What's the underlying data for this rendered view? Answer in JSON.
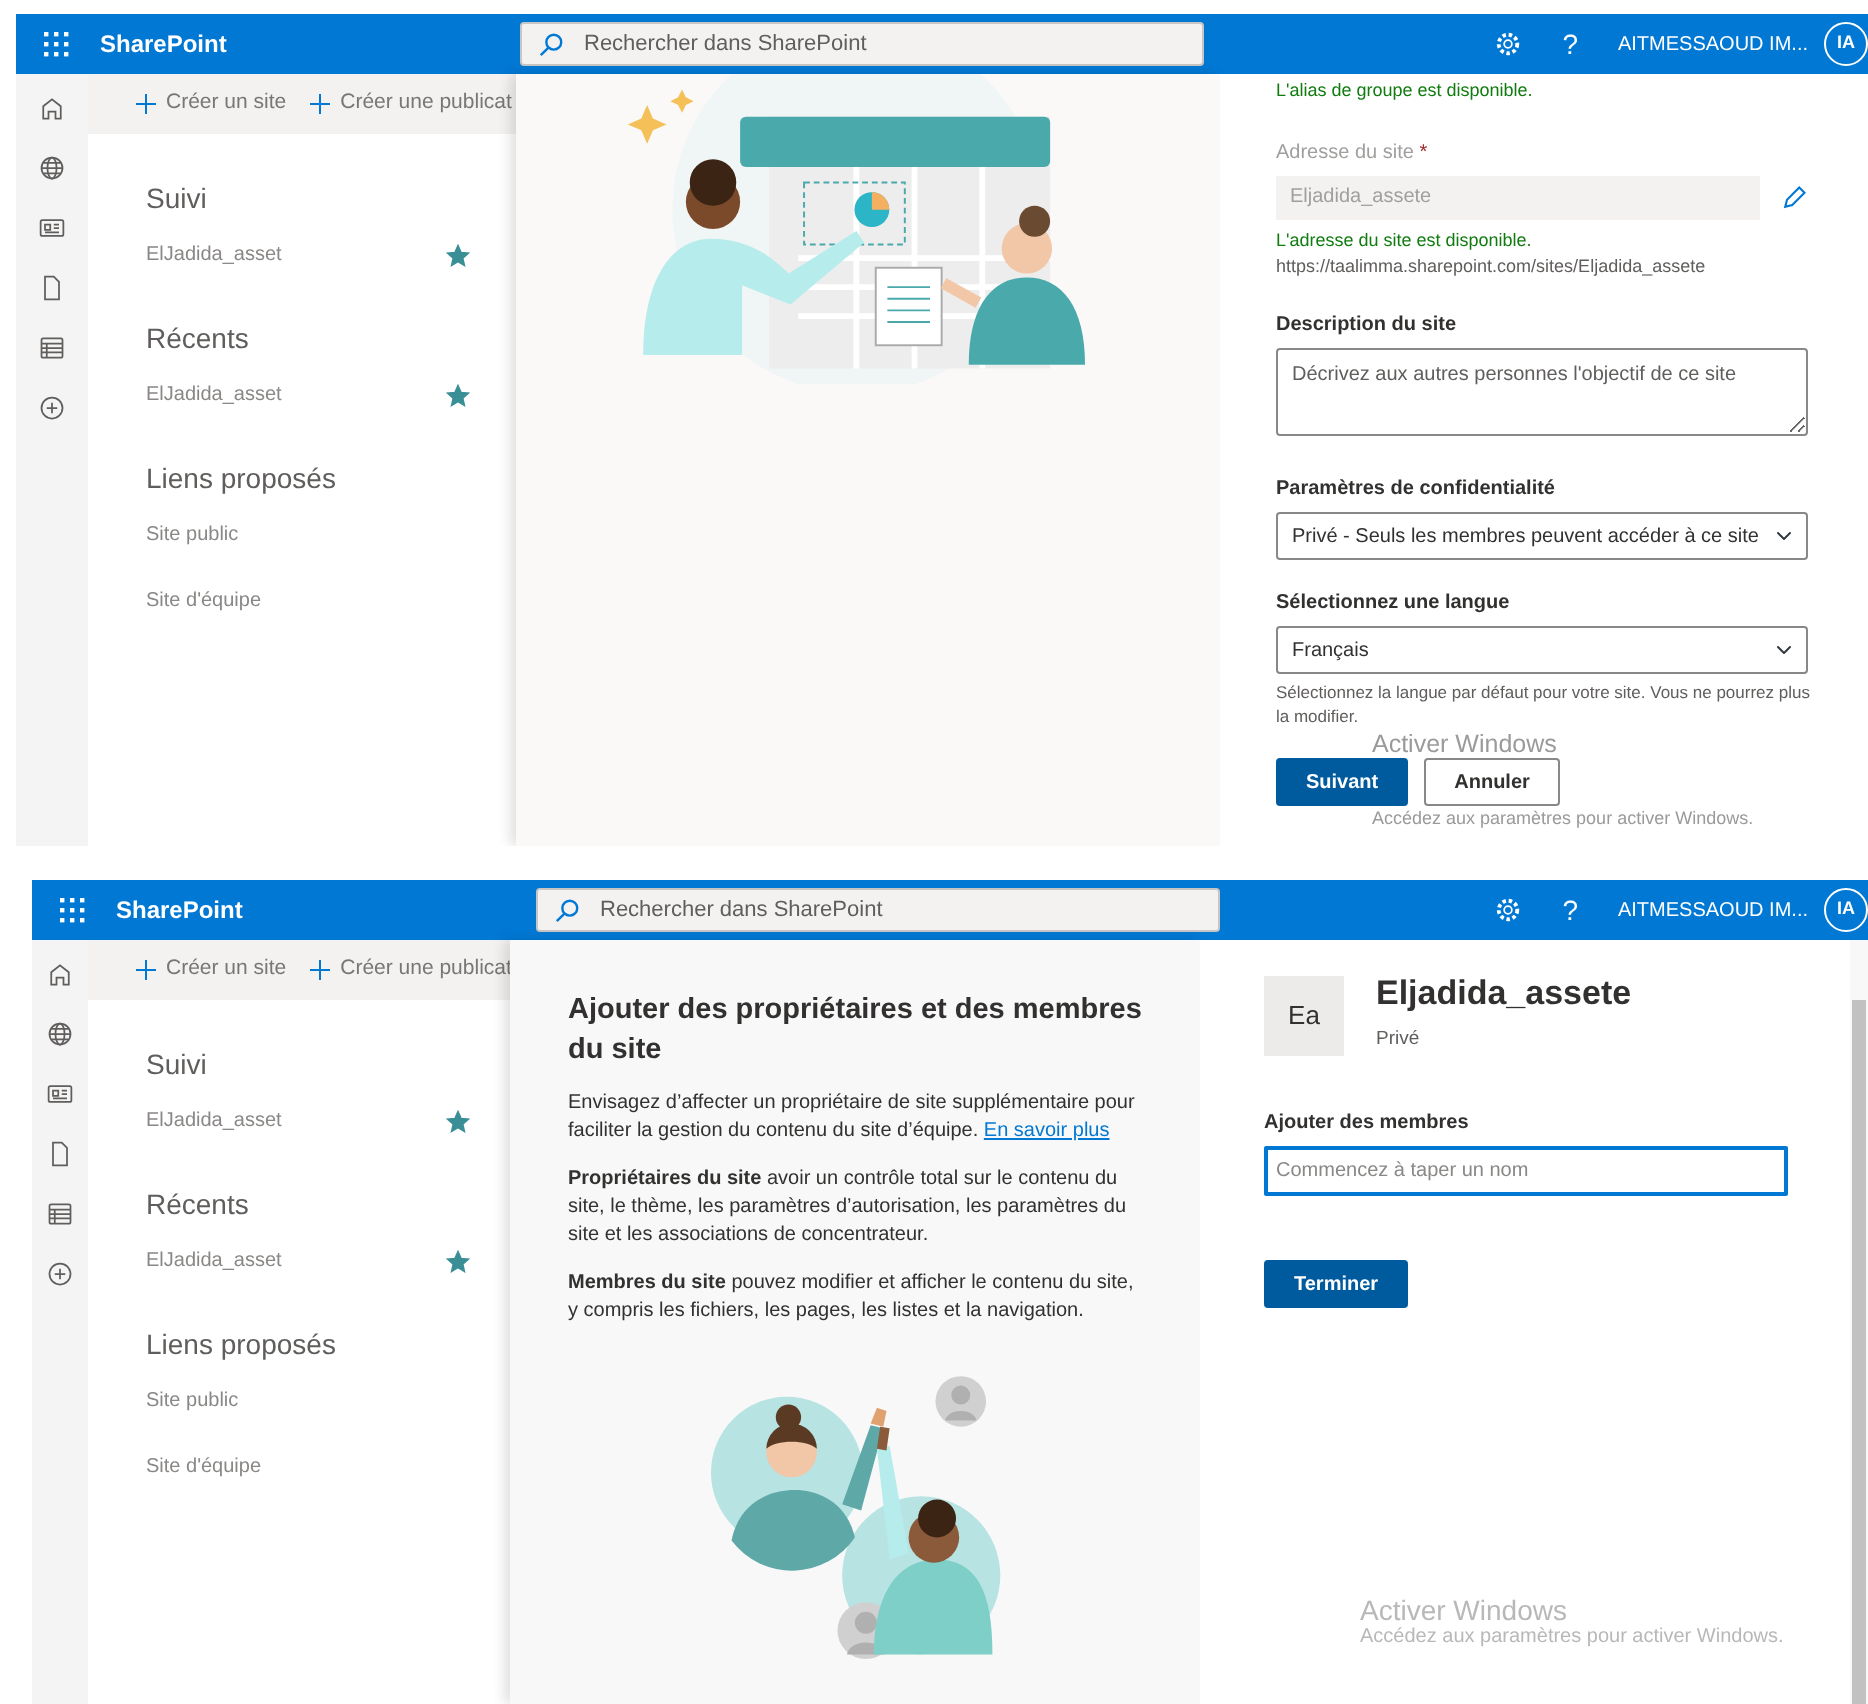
{
  "screens": [
    {
      "kind": "create-site",
      "header": {
        "app_name": "SharePoint",
        "search_placeholder": "Rechercher dans SharePoint",
        "help": "?",
        "user_name": "AITMESSAOUD IM...",
        "avatar_initials": "IA"
      },
      "commands": [
        "Créer un site",
        "Créer une publicat"
      ],
      "nav_sections": [
        {
          "title": "Suivi",
          "items": [
            {
              "label": "ElJadida_asset",
              "favorite": true
            }
          ]
        },
        {
          "title": "Récents",
          "items": [
            {
              "label": "ElJadida_asset",
              "favorite": true
            }
          ]
        },
        {
          "title": "Liens proposés",
          "items": [
            {
              "label": "Site public"
            },
            {
              "label": "Site d'équipe"
            }
          ]
        }
      ],
      "form": {
        "alias_status": "L'alias de groupe est disponible.",
        "address_label": "Adresse du site",
        "required_mark": "*",
        "address_value": "Eljadida_assete",
        "address_status": "L'adresse du site est disponible.",
        "address_url": "https://taalimma.sharepoint.com/sites/Eljadida_assete",
        "description_label": "Description du site",
        "description_placeholder": "Décrivez aux autres personnes l'objectif de ce site",
        "privacy_label": "Paramètres de confidentialité",
        "privacy_value": "Privé - Seuls les membres peuvent accéder à ce site",
        "language_label": "Sélectionnez une langue",
        "language_value": "Français",
        "language_hint": "Sélectionnez la langue par défaut pour votre site. Vous ne pourrez plus la modifier.",
        "buttons": [
          {
            "label": "Suivant",
            "primary": true
          },
          {
            "label": "Annuler",
            "primary": false
          }
        ]
      },
      "activation_notice": {
        "title": "Activer Windows",
        "text": "Accédez aux paramètres pour activer Windows."
      }
    },
    {
      "kind": "add-members",
      "header": {
        "app_name": "SharePoint",
        "search_placeholder": "Rechercher dans SharePoint",
        "help": "?",
        "user_name": "AITMESSAOUD IM...",
        "avatar_initials": "IA"
      },
      "commands": [
        "Créer un site",
        "Créer une publicat"
      ],
      "nav_sections": [
        {
          "title": "Suivi",
          "items": [
            {
              "label": "ElJadida_asset",
              "favorite": true
            }
          ]
        },
        {
          "title": "Récents",
          "items": [
            {
              "label": "ElJadida_asset",
              "favorite": true
            }
          ]
        },
        {
          "title": "Liens proposés",
          "items": [
            {
              "label": "Site public"
            },
            {
              "label": "Site d'équipe"
            }
          ]
        }
      ],
      "intro": {
        "title": "Ajouter des propriétaires et des membres du site",
        "paragraphs": [
          {
            "text": "Envisagez d’affecter un propriétaire de site supplémentaire pour faciliter la gestion du contenu du site d’équipe.",
            "link": "En savoir plus"
          },
          {
            "text": "**Propriétaires du site** avoir un contrôle total sur le contenu du site, le thème, les paramètres d’autorisation, les paramètres du site et les associations de concentrateur."
          },
          {
            "text": "**Membres du site** pouvez modifier et afficher le contenu du site, y compris les fichiers, les pages, les listes et la navigation."
          }
        ]
      },
      "members": {
        "site_initials": "Ea",
        "site_name": "Eljadida_assete",
        "privacy": "Privé",
        "field_label": "Ajouter des membres",
        "field_placeholder": "Commencez à taper un nom",
        "focused": true,
        "buttons": [
          {
            "label": "Terminer",
            "primary": true
          }
        ]
      },
      "activation_notice": {
        "title": "Activer Windows",
        "text": "Accédez aux paramètres pour activer Windows."
      }
    }
  ]
}
